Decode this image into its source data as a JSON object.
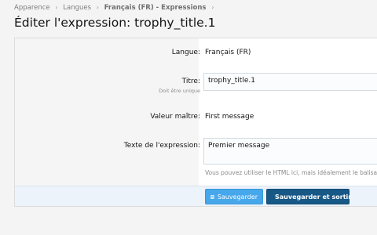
{
  "breadcrumb": {
    "items": [
      "Apparence",
      "Langues",
      "Français (FR) - Expressions"
    ],
    "separator": "›"
  },
  "page": {
    "title": "Éditer l'expression: trophy_title.1"
  },
  "form": {
    "language": {
      "label": "Langue:",
      "value": "Français (FR)"
    },
    "title": {
      "label": "Titre:",
      "hint": "Doit être unique",
      "value": "trophy_title.1"
    },
    "master_value": {
      "label": "Valeur maître:",
      "value": "First message"
    },
    "expression_text": {
      "label": "Texte de l'expression:",
      "value": "Premier message",
      "explain": "Vous pouvez utiliser le HTML ici, mais idéalement le balisa"
    }
  },
  "buttons": {
    "save_label": "Sauvegarder",
    "save_exit_label": "Sauvegarder et sortir",
    "icon": "save-icon"
  },
  "colors": {
    "primary_button": "#47a7eb",
    "dark_button": "#185886",
    "button_bar": "#edf3fa"
  }
}
